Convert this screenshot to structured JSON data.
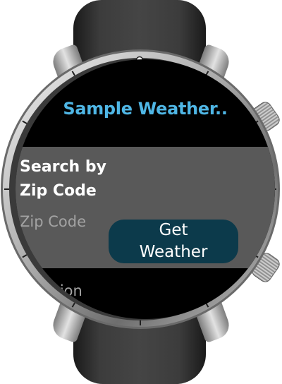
{
  "app": {
    "title": "Sample Weather.."
  },
  "search": {
    "heading": "Search by Zip Code",
    "zip_placeholder": "Zip Code",
    "zip_value": "",
    "button_label": "Get Weather"
  },
  "footer": {
    "location_label": "Location"
  },
  "colors": {
    "title_accent": "#4fb6e5",
    "panel_background": "#595959",
    "button_background": "#0c3a4b",
    "screen_background": "#000000",
    "placeholder_text": "#a3a3a3"
  }
}
